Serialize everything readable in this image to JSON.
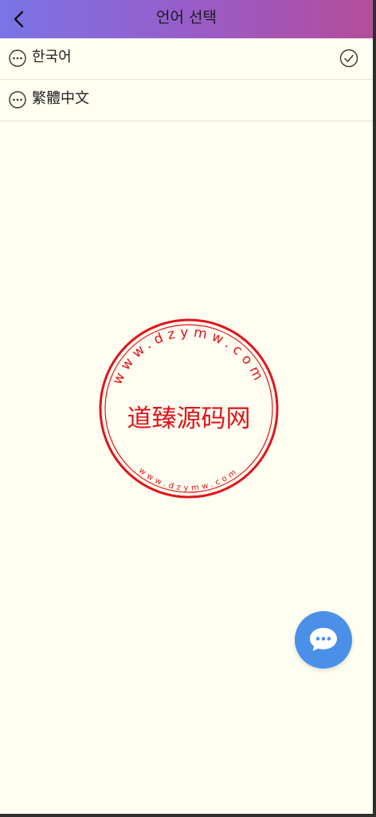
{
  "header": {
    "title": "언어 선택"
  },
  "languages": [
    {
      "label": "한국어",
      "selected": true
    },
    {
      "label": "繁體中文",
      "selected": false
    }
  ],
  "watermark": {
    "text": "道臻源码网",
    "ring_text": "www.dzymw.com",
    "color": "#e0141b"
  },
  "colors": {
    "header_start": "#7a74e6",
    "header_end": "#b44d9a",
    "background": "#fffef0",
    "fab": "#4a90e8"
  },
  "icons": {
    "back": "chevron-left-icon",
    "language_item": "more-circle-icon",
    "selected": "check-circle-icon",
    "fab": "chat-bubble-icon"
  }
}
